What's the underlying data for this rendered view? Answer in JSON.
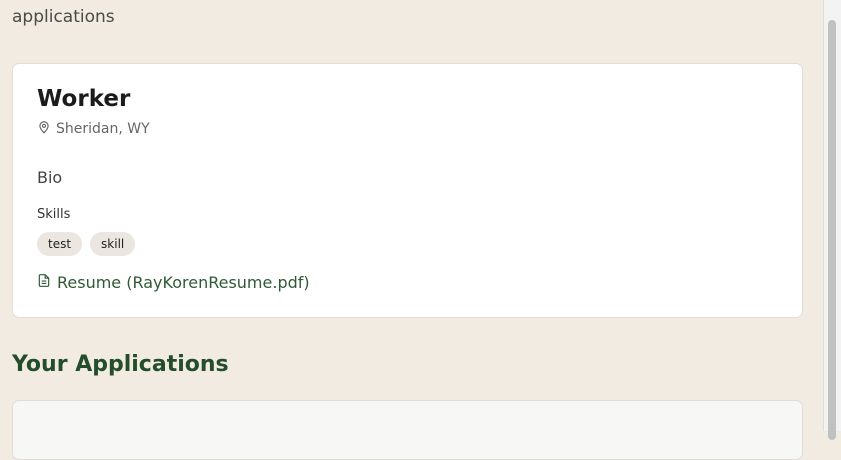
{
  "header": {
    "intro_tail": "applications"
  },
  "profile": {
    "name": "Worker",
    "location": "Sheridan, WY",
    "bio": "Bio",
    "skills_label": "Skills",
    "skills": [
      "test",
      "skill"
    ],
    "resume_label": "Resume (RayKorenResume.pdf)"
  },
  "applications": {
    "title": "Your Applications"
  },
  "icons": {
    "location": "map-pin-icon",
    "resume": "document-icon"
  },
  "colors": {
    "background": "#f1ebe1",
    "accent_green": "#244d2c",
    "link_green": "#2f5a37"
  }
}
